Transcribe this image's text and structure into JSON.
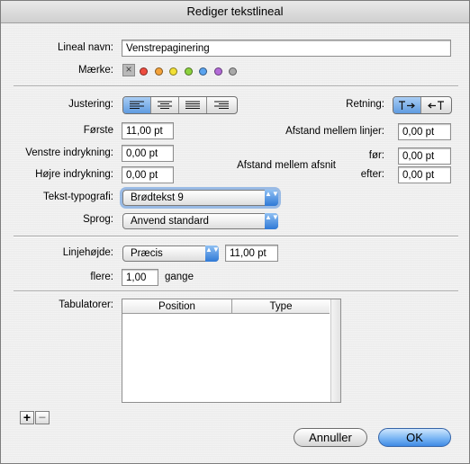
{
  "window": {
    "title": "Rediger tekstlineal"
  },
  "name": {
    "label": "Lineal navn:",
    "value": "Venstrepaginering"
  },
  "mark": {
    "label": "Mærke:",
    "colors": [
      "#ee4c3f",
      "#f3a23a",
      "#f2e036",
      "#8cd23e",
      "#5aa3ef",
      "#b36bd8",
      "#a9a9a9"
    ]
  },
  "alignment": {
    "label": "Justering:",
    "options": [
      "align-left-icon",
      "align-center-icon",
      "align-justify-icon",
      "align-right-icon"
    ],
    "selected": 0
  },
  "direction": {
    "label": "Retning:",
    "options": [
      "direction-ltr-icon",
      "direction-rtl-icon"
    ],
    "selected": 0
  },
  "indent": {
    "first_label": "Første",
    "first_value": "11,00 pt",
    "left_label": "Venstre indrykning:",
    "left_value": "0,00 pt",
    "right_label": "Højre indrykning:",
    "right_value": "0,00 pt"
  },
  "spacing": {
    "lines_label": "Afstand mellem linjer:",
    "lines_value": "0,00 pt",
    "paragraphs_label": "Afstand mellem afsnit",
    "before_label": "før:",
    "before_value": "0,00 pt",
    "after_label": "efter:",
    "after_value": "0,00 pt"
  },
  "style": {
    "label": "Tekst-typografi:",
    "value": "Brødtekst 9"
  },
  "language": {
    "label": "Sprog:",
    "value": "Anvend standard"
  },
  "line_height": {
    "label": "Linjehøjde:",
    "mode": "Præcis",
    "value": "11,00 pt",
    "multiple_label": "flere:",
    "multiple_value": "1,00",
    "multiple_unit": "gange"
  },
  "tabs": {
    "label": "Tabulatorer:",
    "columns": [
      "Position",
      "Type"
    ],
    "rows": []
  },
  "buttons": {
    "add": "+",
    "remove": "−",
    "cancel": "Annuller",
    "ok": "OK"
  },
  "glyphs": {
    "close": "×",
    "arrows": "▲▼"
  }
}
